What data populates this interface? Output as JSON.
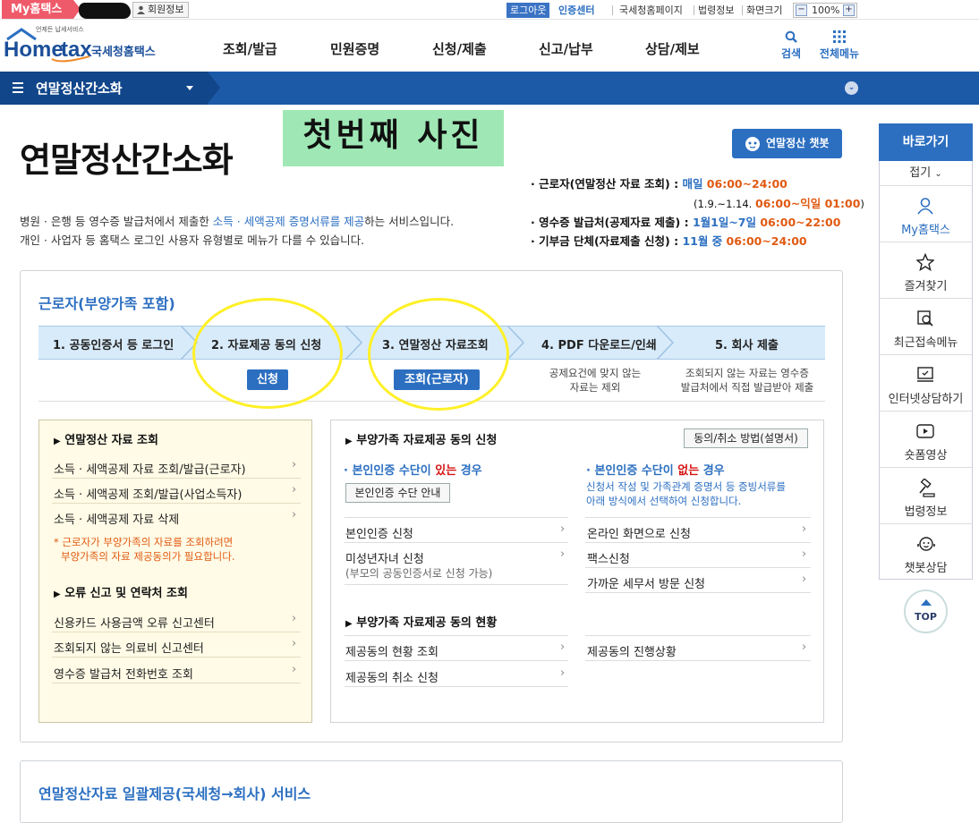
{
  "topbar": {
    "my_hometax": "My홈택스",
    "member_info": "회원정보",
    "logout": "로그아웃",
    "auth_center": "인증센터",
    "nts_homepage": "국세청홈페이지",
    "law_info": "법령정보",
    "screen_size": "화면크기",
    "zoom": "100%"
  },
  "logo": {
    "brand": "Hometax",
    "tagline": "국세청홈택스",
    "small": "언제든 납세서비스"
  },
  "gnb": [
    "조회/발급",
    "민원증명",
    "신청/제출",
    "신고/납부",
    "상담/제보"
  ],
  "header_tools": {
    "search": "검색",
    "all_menu": "전체메뉴"
  },
  "band": {
    "title": "연말정산간소화"
  },
  "page": {
    "title": "연말정산간소화",
    "first_photo": "첫번째 사진",
    "chatbot": "연말정산 챗봇",
    "desc1_a": "병원 · 은행 등 영수증 발급처에서 제출한 ",
    "desc1_b": "소득 · 세액공제 증명서류를 제공",
    "desc1_c": "하는 서비스입니다.",
    "desc2": "개인 · 사업자 등 홈택스 로그인 사용자 유형별로 메뉴가 다를 수 있습니다."
  },
  "schedule": [
    {
      "label": "· 근로자(연말정산 자료 조회) : ",
      "day": "매일 ",
      "time": "06:00~24:00"
    },
    {
      "label": "",
      "day": "(1.9.~1.14. ",
      "time": "06:00~익일 01:00",
      "suffix": ")"
    },
    {
      "label": "· 영수증 발급처(공제자료 제출) : ",
      "day": "1월1일~7일 ",
      "time": "06:00~22:00"
    },
    {
      "label": "· 기부금 단체(자료제출 신청) : ",
      "day": "11월 중 ",
      "time": "06:00~24:00"
    }
  ],
  "section": {
    "title": "근로자(부양가족 포함)",
    "steps": [
      "1. 공동인증서 등 로그인",
      "2. 자료제공 동의 신청",
      "3. 연말정산 자료조회",
      "4. PDF 다운로드/인쇄",
      "5. 회사 제출"
    ],
    "apply_btn": "신청",
    "inquiry_btn": "조회(근로자)",
    "note4": [
      "공제요건에 맞지 않는",
      "자료는 제외"
    ],
    "note5": [
      "조회되지 않는 자료는 영수증",
      "발급처에서 직접 발급받아 제출"
    ]
  },
  "left_panel": {
    "h1": "연말정산 자료 조회",
    "items1": [
      "소득 · 세액공제 자료 조회/발급(근로자)",
      "소득 · 세액공제 조회/발급(사업소득자)",
      "소득 · 세액공제 자료 삭제"
    ],
    "warn": [
      "* 근로자가 부양가족의 자료를 조회하려면",
      "부양가족의 자료 제공동의가 필요합니다."
    ],
    "h2": "오류 신고 및 연락처 조회",
    "items2": [
      "신용카드 사용금액 오류 신고센터",
      "조회되지 않는 의료비 신고센터",
      "영수증 발급처 전화번호 조회"
    ]
  },
  "right_panel": {
    "h1": "부양가족 자료제공 동의 신청",
    "guide_btn": "동의/취소 방법(설명서)",
    "sub_yes_a": "· 본인인증 수단이 ",
    "sub_yes_b": "있는",
    "sub_yes_c": " 경우",
    "auth_guide_btn": "본인인증 수단 안내",
    "sub_no_a": "· 본인인증 수단이 ",
    "sub_no_b": "없는",
    "sub_no_c": " 경우",
    "no_desc": [
      "신청서 작성 및 가족관계 증명서 등 증빙서류를",
      "아래 방식에서 선택하여 신청합니다."
    ],
    "left_items": [
      "본인인증 신청",
      "미성년자녀 신청"
    ],
    "minor_note": "(부모의 공동인증서로 신청 가능)",
    "right_items": [
      "온라인 화면으로 신청",
      "팩스신청",
      "가까운 세무서 방문 신청"
    ],
    "h2": "부양가족 자료제공 동의 현황",
    "status_left": [
      "제공동의 현황 조회",
      "제공동의 취소 신청"
    ],
    "status_right": [
      "제공동의 진행상황"
    ]
  },
  "bottom": {
    "title": "연말정산자료 일괄제공(국세청→회사) 서비스"
  },
  "quick": {
    "head": "바로가기",
    "fold": "접기",
    "items": [
      "My홈택스",
      "즐겨찾기",
      "최근접속메뉴",
      "인터넷상담하기",
      "숏폼영상",
      "법령정보",
      "챗봇상담"
    ],
    "top": "TOP"
  },
  "icons": {
    "arrow": "›",
    "triangle": "▶"
  },
  "colors": {
    "accent": "#2c6fc1",
    "band": "#1c5aa8",
    "badge": "#ef5a6a",
    "time": "#e05a12",
    "highlight": "#9fe8b5",
    "annotation": "#fff027"
  }
}
